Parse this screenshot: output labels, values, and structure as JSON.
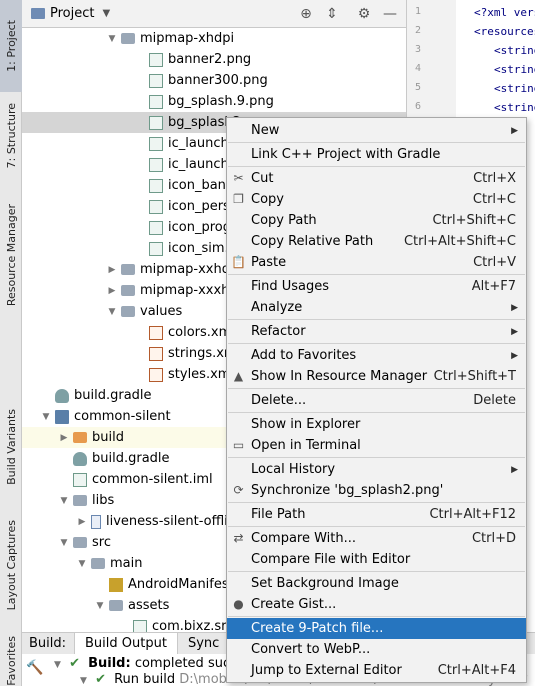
{
  "left_strip": {
    "tabs": [
      "1: Project",
      "7: Structure",
      "Resource Manager",
      "Build Variants",
      "Layout Captures",
      "Favorites"
    ]
  },
  "project_panel": {
    "title": "Project",
    "tree": [
      {
        "label": "mipmap-xhdpi",
        "kind": "folder",
        "arrow": "open"
      },
      {
        "label": "banner2.png",
        "kind": "file"
      },
      {
        "label": "banner300.png",
        "kind": "file"
      },
      {
        "label": "bg_splash.9.png",
        "kind": "file"
      },
      {
        "label": "bg_splash2",
        "kind": "file"
      },
      {
        "label": "ic_launche",
        "kind": "file"
      },
      {
        "label": "ic_launche",
        "kind": "file"
      },
      {
        "label": "icon_bank",
        "kind": "file"
      },
      {
        "label": "icon_pers",
        "kind": "file"
      },
      {
        "label": "icon_prog",
        "kind": "file"
      },
      {
        "label": "icon_sim.p",
        "kind": "file"
      },
      {
        "label": "mipmap-xxhd",
        "kind": "folder",
        "arrow": "closed"
      },
      {
        "label": "mipmap-xxxh",
        "kind": "folder",
        "arrow": "closed"
      },
      {
        "label": "values",
        "kind": "folder",
        "arrow": "open"
      },
      {
        "label": "colors.xm",
        "kind": "xml"
      },
      {
        "label": "strings.xm",
        "kind": "xml"
      },
      {
        "label": "styles.xml",
        "kind": "xml"
      },
      {
        "label": "build.gradle",
        "kind": "gradle"
      },
      {
        "label": "common-silent",
        "kind": "module",
        "arrow": "open"
      },
      {
        "label": "build",
        "kind": "folder-orange",
        "arrow": "closed"
      },
      {
        "label": "build.gradle",
        "kind": "gradle"
      },
      {
        "label": "common-silent.iml",
        "kind": "file"
      },
      {
        "label": "libs",
        "kind": "folder",
        "arrow": "open"
      },
      {
        "label": "liveness-silent-offlin",
        "kind": "lib",
        "arrow": "closed"
      },
      {
        "label": "src",
        "kind": "folder",
        "arrow": "open"
      },
      {
        "label": "main",
        "kind": "folder",
        "arrow": "open"
      },
      {
        "label": "AndroidManifes",
        "kind": "manifest"
      },
      {
        "label": "assets",
        "kind": "folder",
        "arrow": "open"
      },
      {
        "label": "com.bixz.srhy",
        "kind": "file"
      }
    ]
  },
  "editor": {
    "line_numbers": [
      "1",
      "2",
      "3",
      "4",
      "5",
      "6"
    ],
    "lines": [
      "<?xml versi",
      "<resources>",
      "<string",
      "<string",
      "<string",
      "<string"
    ]
  },
  "context_menu": {
    "items": [
      {
        "label": "New",
        "shortcut": "",
        "submenu": true,
        "icon": ""
      },
      {
        "sep": true
      },
      {
        "label": "Link C++ Project with Gradle",
        "shortcut": "",
        "icon": ""
      },
      {
        "sep": true
      },
      {
        "label": "Cut",
        "shortcut": "Ctrl+X",
        "icon": "cut-icon"
      },
      {
        "label": "Copy",
        "shortcut": "Ctrl+C",
        "icon": "copy-icon"
      },
      {
        "label": "Copy Path",
        "shortcut": "Ctrl+Shift+C",
        "icon": ""
      },
      {
        "label": "Copy Relative Path",
        "shortcut": "Ctrl+Alt+Shift+C",
        "icon": ""
      },
      {
        "label": "Paste",
        "shortcut": "Ctrl+V",
        "icon": "paste-icon"
      },
      {
        "sep": true
      },
      {
        "label": "Find Usages",
        "shortcut": "Alt+F7",
        "icon": ""
      },
      {
        "label": "Analyze",
        "shortcut": "",
        "submenu": true,
        "icon": ""
      },
      {
        "sep": true
      },
      {
        "label": "Refactor",
        "shortcut": "",
        "submenu": true,
        "icon": ""
      },
      {
        "sep": true
      },
      {
        "label": "Add to Favorites",
        "shortcut": "",
        "submenu": true,
        "icon": ""
      },
      {
        "label": "Show In Resource Manager",
        "shortcut": "Ctrl+Shift+T",
        "icon": "resource-manager-icon"
      },
      {
        "sep": true
      },
      {
        "label": "Delete...",
        "shortcut": "Delete",
        "icon": ""
      },
      {
        "sep": true
      },
      {
        "label": "Show in Explorer",
        "shortcut": "",
        "icon": ""
      },
      {
        "label": "Open in Terminal",
        "shortcut": "",
        "icon": "terminal-icon"
      },
      {
        "sep": true
      },
      {
        "label": "Local History",
        "shortcut": "",
        "submenu": true,
        "icon": ""
      },
      {
        "label": "Synchronize 'bg_splash2.png'",
        "shortcut": "",
        "icon": "sync-icon"
      },
      {
        "sep": true
      },
      {
        "label": "File Path",
        "shortcut": "Ctrl+Alt+F12",
        "icon": ""
      },
      {
        "sep": true
      },
      {
        "label": "Compare With...",
        "shortcut": "Ctrl+D",
        "icon": "compare-icon"
      },
      {
        "label": "Compare File with Editor",
        "shortcut": "",
        "icon": ""
      },
      {
        "sep": true
      },
      {
        "label": "Set Background Image",
        "shortcut": "",
        "icon": ""
      },
      {
        "label": "Create Gist...",
        "shortcut": "",
        "icon": "github-icon"
      },
      {
        "sep": true
      },
      {
        "label": "Create 9-Patch file...",
        "shortcut": "",
        "icon": "",
        "active": true
      },
      {
        "label": "Convert to WebP...",
        "shortcut": "",
        "icon": ""
      },
      {
        "label": "Jump to External Editor",
        "shortcut": "Ctrl+Alt+F4",
        "icon": ""
      }
    ]
  },
  "build_bar": {
    "label": "Build:",
    "tabs": [
      "Build Output",
      "Sync"
    ],
    "line1_bold": "Build:",
    "line1_rest": " completed succe",
    "line2": "Run build",
    "line2_path": "D:\\mobile\\src\\demo\\ChinaNet\\XinduZondIdentityVenv"
  }
}
